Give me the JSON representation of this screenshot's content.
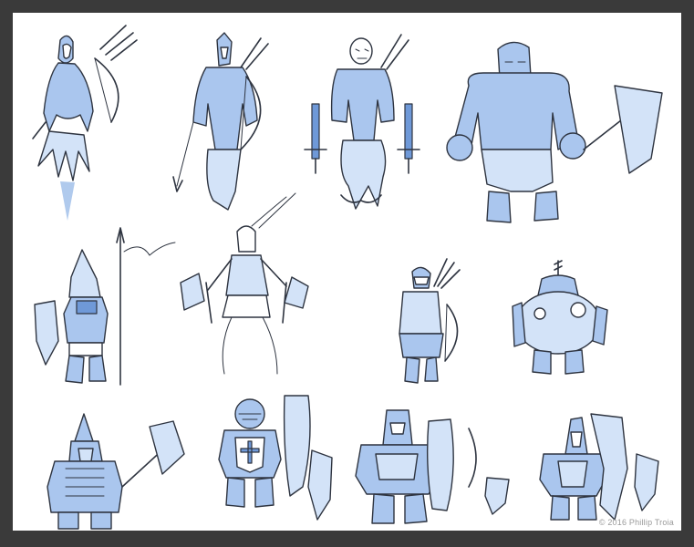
{
  "artwork": {
    "credit": "© 2016 Phillip Troia",
    "figures": [
      {
        "icon": "hooded-archer-figure"
      },
      {
        "icon": "armored-archer-figure"
      },
      {
        "icon": "skull-spirit-figure"
      },
      {
        "icon": "brute-axe-figure"
      },
      {
        "icon": "knight-spear-figure"
      },
      {
        "icon": "dual-axe-warrior-figure"
      },
      {
        "icon": "ranger-figure"
      },
      {
        "icon": "mech-dwarf-figure"
      },
      {
        "icon": "spiked-dwarf-figure"
      },
      {
        "icon": "shield-knight-figure"
      },
      {
        "icon": "heavy-knight-figure"
      },
      {
        "icon": "crystal-knight-figure"
      }
    ],
    "colors": {
      "frame": "#3a3a3a",
      "paper": "#ffffff",
      "ink": "#2e3440",
      "wash": "#aac6ee"
    }
  }
}
